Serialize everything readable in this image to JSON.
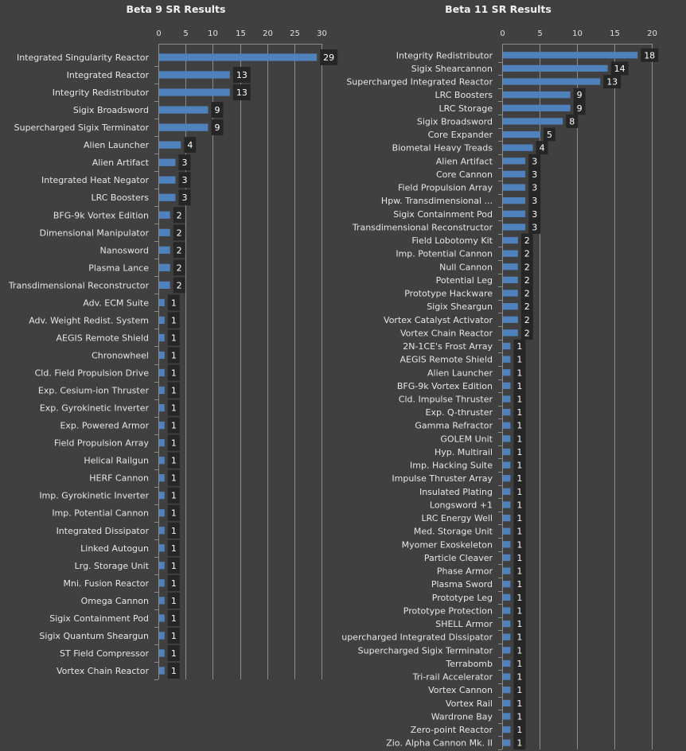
{
  "chart_data": [
    {
      "type": "bar",
      "orientation": "horizontal",
      "title": "Beta 9 SR Results",
      "xlabel": "",
      "ylabel": "",
      "xlim": [
        0,
        30
      ],
      "xticks": [
        0,
        5,
        10,
        15,
        20,
        25,
        30
      ],
      "tick_labels": [
        "0",
        "5",
        "10",
        "15",
        "20",
        "25",
        "30"
      ],
      "axis_position": "top",
      "grid": true,
      "legend": "none",
      "bar_color": "#4f81bd",
      "label_bg": "#262626",
      "categories": [
        "Integrated Singularity Reactor",
        "Integrated Reactor",
        "Integrity Redistributor",
        "Sigix Broadsword",
        "Supercharged Sigix Terminator",
        "Alien Launcher",
        "Alien Artifact",
        "Integrated Heat Negator",
        "LRC Boosters",
        "BFG-9k Vortex Edition",
        "Dimensional Manipulator",
        "Nanosword",
        "Plasma Lance",
        "Transdimensional Reconstructor",
        "Adv. ECM Suite",
        "Adv. Weight Redist. System",
        "AEGIS Remote Shield",
        "Chronowheel",
        "Cld. Field Propulsion Drive",
        "Exp. Cesium-ion Thruster",
        "Exp. Gyrokinetic Inverter",
        "Exp. Powered Armor",
        "Field Propulsion Array",
        "Helical Railgun",
        "HERF Cannon",
        "Imp. Gyrokinetic Inverter",
        "Imp. Potential Cannon",
        "Integrated Dissipator",
        "Linked Autogun",
        "Lrg. Storage Unit",
        "Mni. Fusion Reactor",
        "Omega Cannon",
        "Sigix Containment Pod",
        "Sigix Quantum Sheargun",
        "ST Field Compressor",
        "Vortex Chain Reactor"
      ],
      "values": [
        29,
        13,
        13,
        9,
        9,
        4,
        3,
        3,
        3,
        2,
        2,
        2,
        2,
        2,
        1,
        1,
        1,
        1,
        1,
        1,
        1,
        1,
        1,
        1,
        1,
        1,
        1,
        1,
        1,
        1,
        1,
        1,
        1,
        1,
        1,
        1
      ]
    },
    {
      "type": "bar",
      "orientation": "horizontal",
      "title": "Beta 11 SR Results",
      "xlabel": "",
      "ylabel": "",
      "xlim": [
        0,
        20
      ],
      "xticks": [
        0,
        5,
        10,
        15,
        20
      ],
      "tick_labels": [
        "0",
        "5",
        "10",
        "15",
        "20"
      ],
      "axis_position": "top",
      "grid": true,
      "legend": "none",
      "bar_color": "#4f81bd",
      "label_bg": "#262626",
      "categories": [
        "Integrity Redistributor",
        "Sigix Shearcannon",
        "Supercharged Integrated Reactor",
        "LRC Boosters",
        "LRC Storage",
        "Sigix Broadsword",
        "Core Expander",
        "Biometal Heavy Treads",
        "Alien Artifact",
        "Core Cannon",
        "Field Propulsion Array",
        "Hpw. Transdimensional ...",
        "Sigix Containment Pod",
        "Transdimensional Reconstructor",
        "Field Lobotomy Kit",
        "Imp. Potential Cannon",
        "Null Cannon",
        "Potential Leg",
        "Prototype Hackware",
        "Sigix Sheargun",
        "Vortex Catalyst Activator",
        "Vortex Chain Reactor",
        "2N-1CE's Frost Array",
        "AEGIS Remote Shield",
        "Alien Launcher",
        "BFG-9k Vortex Edition",
        "Cld. Impulse Thruster",
        "Exp. Q-thruster",
        "Gamma Refractor",
        "GOLEM Unit",
        "Hyp. Multirail",
        "Imp. Hacking Suite",
        "Impulse Thruster Array",
        "Insulated Plating",
        "Longsword +1",
        "LRC Energy Well",
        "Med. Storage Unit",
        "Myomer Exoskeleton",
        "Particle Cleaver",
        "Phase Armor",
        "Plasma Sword",
        "Prototype Leg",
        "Prototype Protection",
        "SHELL Armor",
        "Supercharged Integrated Dissipator",
        "Supercharged Sigix Terminator",
        "Terrabomb",
        "Tri-rail Accelerator",
        "Vortex Cannon",
        "Vortex Rail",
        "Wardrone Bay",
        "Zero-point Reactor",
        "Zio. Alpha Cannon Mk. II"
      ],
      "values": [
        18,
        14,
        13,
        9,
        9,
        8,
        5,
        4,
        3,
        3,
        3,
        3,
        3,
        3,
        2,
        2,
        2,
        2,
        2,
        2,
        2,
        2,
        1,
        1,
        1,
        1,
        1,
        1,
        1,
        1,
        1,
        1,
        1,
        1,
        1,
        1,
        1,
        1,
        1,
        1,
        1,
        1,
        1,
        1,
        1,
        1,
        1,
        1,
        1,
        1,
        1,
        1,
        1
      ]
    }
  ]
}
